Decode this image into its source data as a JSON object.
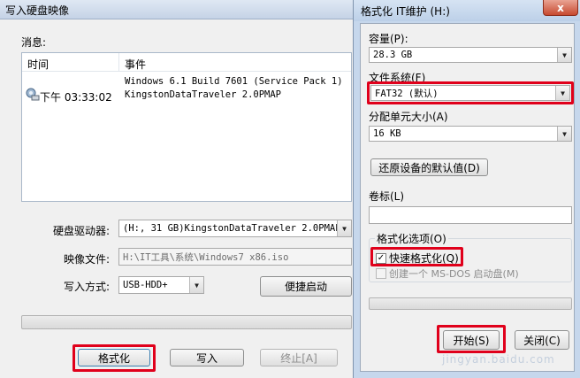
{
  "write_window": {
    "title": "写入硬盘映像",
    "messages_label": "消息:",
    "log": {
      "col_time": "时间",
      "col_event": "事件",
      "rows": [
        {
          "time": "",
          "event": "Windows 6.1 Build 7601 (Service Pack 1)"
        },
        {
          "time": "下午 03:33:02",
          "event": "KingstonDataTraveler 2.0PMAP"
        }
      ]
    },
    "drive_label": "硬盘驱动器:",
    "drive_value": "(H:, 31 GB)KingstonDataTraveler 2.0PMAP",
    "image_label": "映像文件:",
    "image_value": "H:\\IT工具\\系统\\Windows7 x86.iso",
    "method_label": "写入方式:",
    "method_value": "USB-HDD+",
    "quick_boot_label": "便捷启动",
    "format_label": "格式化",
    "write_label": "写入",
    "stop_label": "终止[A]"
  },
  "format_dialog": {
    "title": "格式化 IT维护 (H:)",
    "close_glyph": "x",
    "capacity_label": "容量(P):",
    "capacity_value": "28.3 GB",
    "fs_label": "文件系统(F)",
    "fs_value": "FAT32 (默认)",
    "alloc_label": "分配单元大小(A)",
    "alloc_value": "16 KB",
    "restore_label": "还原设备的默认值(D)",
    "volume_label": "卷标(L)",
    "volume_value": "",
    "options_label": "格式化选项(O)",
    "quick_format_label": "快速格式化(Q)",
    "quick_format_checked": true,
    "msdos_label": "创建一个 MS-DOS 启动盘(M)",
    "msdos_checked": false,
    "start_label": "开始(S)",
    "close_label": "关闭(C)"
  },
  "watermark": "jingyan.baidu.com",
  "icons": {
    "check": "✓",
    "dropdown": "▼",
    "info": "computer-info-icon"
  },
  "colors": {
    "highlight": "#e0001b",
    "dialog_frame": "#c6d7ec"
  }
}
